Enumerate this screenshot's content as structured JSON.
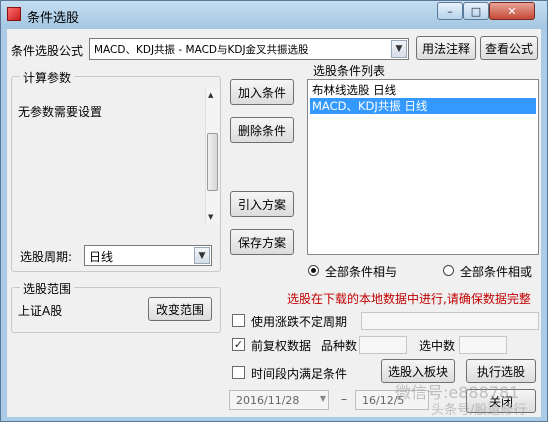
{
  "window": {
    "title": "条件选股",
    "min": "–",
    "max": "□",
    "close": "✕"
  },
  "formula": {
    "label": "条件选股公式",
    "value": "MACD、KDJ共振 - MACD与KDJ金叉共振选股",
    "usage_button": "用法注释",
    "view_button": "查看公式"
  },
  "params": {
    "group_title": "计算参数",
    "none_text": "无参数需要设置",
    "period_label": "选股周期:",
    "period_value": "日线"
  },
  "actions": {
    "add": "加入条件",
    "delete": "删除条件",
    "import": "引入方案",
    "save": "保存方案"
  },
  "conditions": {
    "title": "选股条件列表",
    "items": [
      {
        "label": "布林线选股  日线",
        "selected": false
      },
      {
        "label": "MACD、KDJ共振  日线",
        "selected": true
      }
    ]
  },
  "logic": {
    "and_label": "全部条件相与",
    "or_label": "全部条件相或",
    "selected": "and"
  },
  "notice": "选股在下载的本地数据中进行,请确保数据完整",
  "notice_color": "#c00000",
  "scope": {
    "group_title": "选股范围",
    "value": "上证A股",
    "change_button": "改变范围"
  },
  "options": {
    "uncertain_limit": {
      "label": "使用涨跌不定周期",
      "checked": false
    },
    "adjusted": {
      "label": "前复权数据",
      "checked": true
    },
    "variety_count_label": "品种数",
    "selected_label": "选中数",
    "time_range": {
      "label": "时间段内满足条件",
      "checked": false
    },
    "start_date": "2016/11/28",
    "dash": "–",
    "end_date": "16/12/5"
  },
  "bottom": {
    "to_block": "选股入板块",
    "execute": "执行选股",
    "close": "关闭"
  },
  "watermark": {
    "line1": "微信号:e888781",
    "line2": "头条号/股道修行"
  }
}
